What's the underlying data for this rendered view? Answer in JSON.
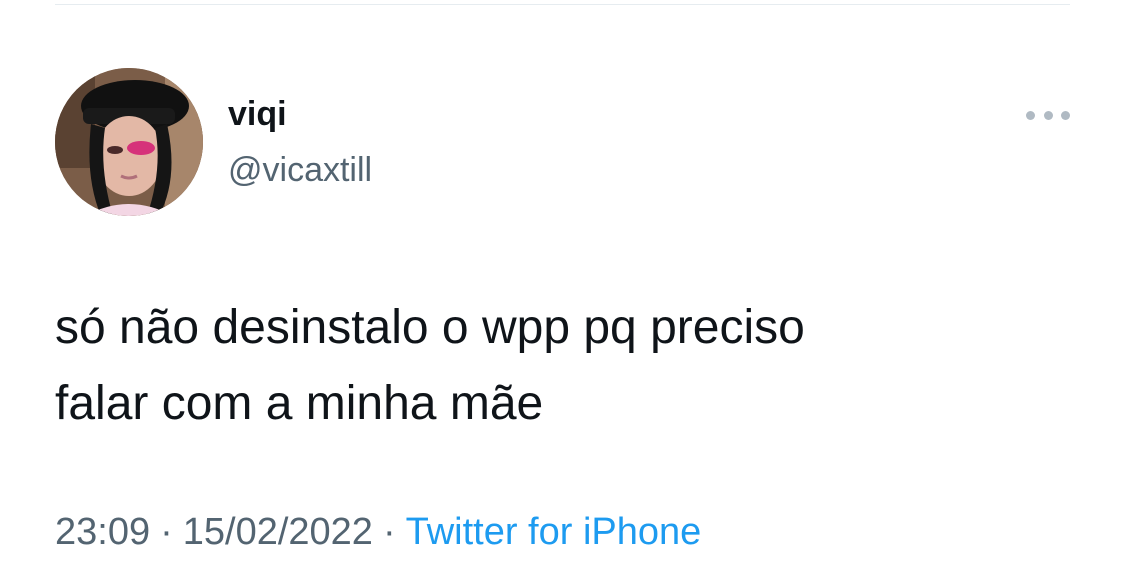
{
  "author": {
    "display_name": "viqi",
    "handle": "@vicaxtill",
    "avatar_icon": "profile-photo"
  },
  "more_icon": "more-horizontal-icon",
  "tweet": {
    "lines": [
      "só não desinstalo o wpp pq preciso",
      "falar com a minha mãe"
    ]
  },
  "meta": {
    "time": "23:09",
    "separator": "·",
    "date": "15/02/2022",
    "source": "Twitter for iPhone"
  },
  "colors": {
    "text": "#0f1419",
    "secondary": "#536471",
    "link": "#1d9bf0",
    "divider": "#e6ecf0"
  }
}
